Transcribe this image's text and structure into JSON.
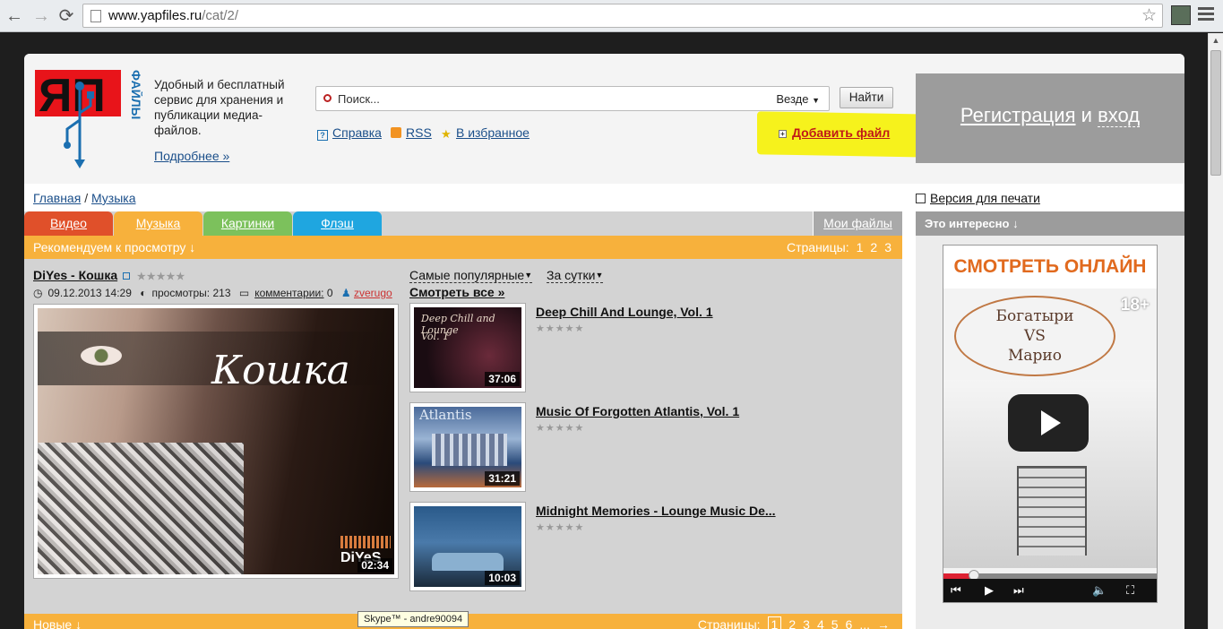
{
  "browser": {
    "url_host": "www.yapfiles.ru",
    "url_path": "/cat/2/",
    "back": "←",
    "forward": "→",
    "reload": "⟳",
    "star": "☆"
  },
  "header": {
    "tagline": "Удобный и бесплатный сервис для хранения и публикации медиа-файлов.",
    "more_link": "Подробнее »",
    "search_placeholder": "Поиск...",
    "search_scope": "Везде",
    "search_button": "Найти",
    "help_link": "Справка",
    "rss_link": "RSS",
    "favorites_link": "В избранное",
    "add_file": "Добавить файл",
    "register": "Регистрация",
    "and": "и",
    "login": "вход"
  },
  "logo": {
    "letters": "ЯП",
    "side": "ФАЙЛЫ"
  },
  "breadcrumb": {
    "home": "Главная",
    "sep": "/",
    "current": "Музыка"
  },
  "print_link": "Версия для печати",
  "tabs": [
    {
      "label": "Видео",
      "color": "#e0502a"
    },
    {
      "label": "Музыка",
      "color": "#f7b13c"
    },
    {
      "label": "Картинки",
      "color": "#7cc15c"
    },
    {
      "label": "Флэш",
      "color": "#1fa6e0"
    }
  ],
  "my_files": "Мои файлы",
  "recommend_bar": {
    "label": "Рекомендуем к просмотру ↓",
    "pages_label": "Страницы:",
    "pages": [
      "1",
      "2",
      "3"
    ]
  },
  "featured": {
    "title": "DiYes - Кошка",
    "stars": "★★★★★",
    "date": "09.12.2013 14:29",
    "views": "просмотры: 213",
    "comments_label": "комментарии:",
    "comments_count": "0",
    "user": "zverugo",
    "script_text": "Кошка",
    "brand_text": "DiYeS",
    "duration": "02:34"
  },
  "sort": {
    "popular": "Самые популярные",
    "period": "За сутки",
    "see_all": "Смотреть все »"
  },
  "items": [
    {
      "title": "Deep Chill And Lounge, Vol. 1",
      "duration": "37:06",
      "stars": "★★★★★",
      "thumb_text": "Deep Chill and Lounge",
      "thumb_sub": "Vol. 1"
    },
    {
      "title": "Music Of Forgotten Atlantis, Vol. 1",
      "duration": "31:21",
      "stars": "★★★★★",
      "thumb_text": "Atlantis",
      "thumb_sub": ""
    },
    {
      "title": "Midnight Memories - Lounge Music De...",
      "duration": "10:03",
      "stars": "★★★★★",
      "thumb_text": "",
      "thumb_sub": ""
    }
  ],
  "new_bar": {
    "label": "Новые ↓",
    "pages_label": "Страницы:",
    "pages": [
      "1",
      "2",
      "3",
      "4",
      "5",
      "6",
      "...",
      "→"
    ],
    "current_page": "1"
  },
  "tooltip": "Skype™ - andre90094",
  "interesting": "Это интересно ↓",
  "ad": {
    "header": "СМОТРЕТЬ ОНЛАЙН",
    "age": "18+",
    "line1": "Богатыри",
    "line2": "VS",
    "line3": "Марио",
    "progress": 0.14
  }
}
